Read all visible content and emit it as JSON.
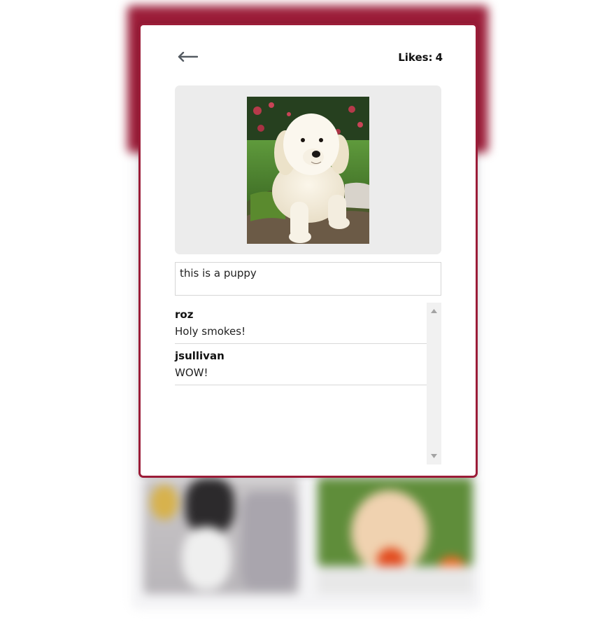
{
  "modal": {
    "back_icon": "arrow-left-icon",
    "likes_label": "Likes:",
    "likes_count": "4",
    "photo_alt": "golden retriever puppy",
    "caption": "this is a puppy"
  },
  "comments": [
    {
      "user": "roz",
      "text": "Holy smokes!"
    },
    {
      "user": "jsullivan",
      "text": "WOW!"
    }
  ],
  "colors": {
    "accent": "#9b1c38",
    "panel_bg": "#ececec",
    "border": "#d6d6d6"
  }
}
